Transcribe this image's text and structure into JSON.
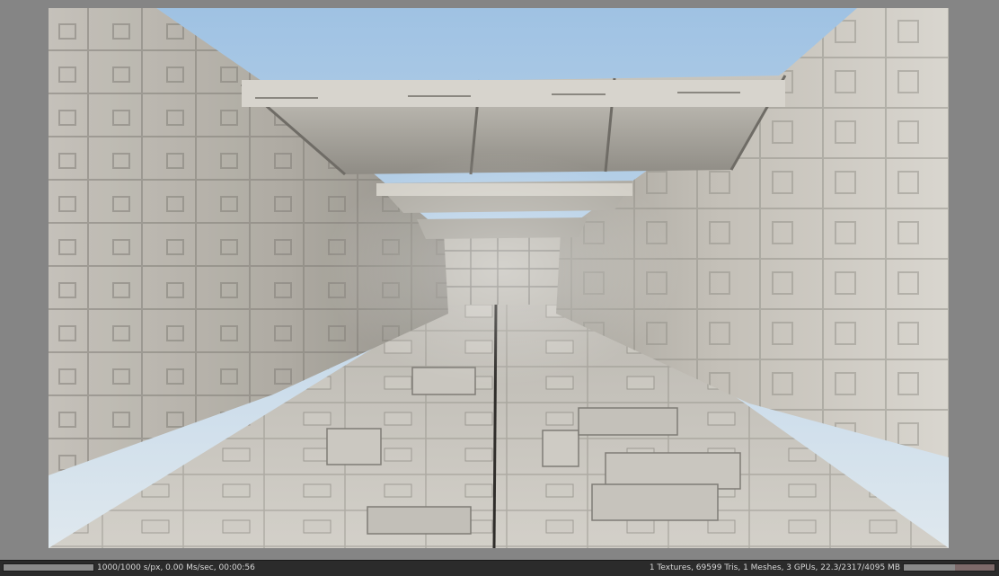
{
  "colors": {
    "window_background": "#858585",
    "statusbar_background": "#2b2b2b",
    "statusbar_text": "#d8d8d8",
    "sky_top": "#b7d1e8",
    "concrete_light": "#d9d6cf",
    "concrete_mid": "#bebab1",
    "concrete_shadow": "#7d7a73"
  },
  "render": {
    "icon": "rendered-3d-scene-concrete-corridor"
  },
  "statusbar": {
    "render_progress": 1.0,
    "render_stats": "1000/1000 s/px, 0.00 Ms/sec, 00:00:56",
    "scene_stats": "1 Textures, 69599 Tris, 1 Meshes, 3 GPUs, 22.3/2317/4095 MB",
    "memory_usage": 0.566
  }
}
